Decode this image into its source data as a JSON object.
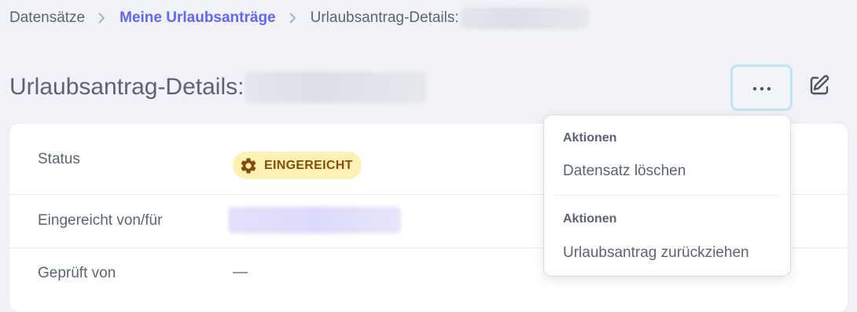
{
  "breadcrumb": {
    "items": [
      {
        "label": "Datensätze"
      },
      {
        "label": "Meine Urlaubsanträge"
      },
      {
        "label": "Urlaubsantrag-Details:"
      }
    ]
  },
  "header": {
    "title": "Urlaubsantrag-Details:",
    "more_label": "···"
  },
  "details": {
    "rows": [
      {
        "label": "Status",
        "badge": "EINGEREICHT"
      },
      {
        "label": "Eingereicht von/für"
      },
      {
        "label": "Geprüft von",
        "value": "—"
      }
    ]
  },
  "menu": {
    "sections": [
      {
        "heading": "Aktionen",
        "item": "Datensatz löschen"
      },
      {
        "heading": "Aktionen",
        "item": "Urlaubsantrag zurückziehen"
      }
    ]
  },
  "colors": {
    "accent": "#6366f1",
    "badge_bg": "#fdf2b3",
    "badge_text": "#8a4b08",
    "focus_ring": "#bfe3f7"
  },
  "icons": {
    "breadcrumb_separator": "chevron-right-icon",
    "status": "gear-icon",
    "edit": "edit-icon",
    "more": "more-horizontal-icon"
  }
}
